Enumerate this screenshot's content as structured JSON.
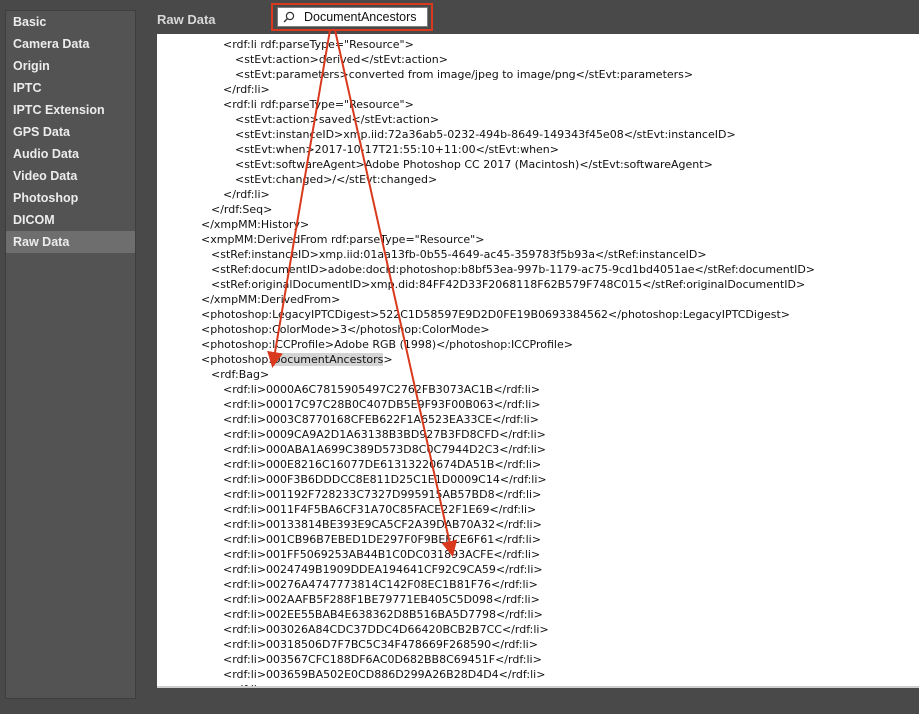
{
  "sidebar": {
    "items": [
      {
        "label": "Basic"
      },
      {
        "label": "Camera Data"
      },
      {
        "label": "Origin"
      },
      {
        "label": "IPTC"
      },
      {
        "label": "IPTC Extension"
      },
      {
        "label": "GPS Data"
      },
      {
        "label": "Audio Data"
      },
      {
        "label": "Video Data"
      },
      {
        "label": "Photoshop"
      },
      {
        "label": "DICOM"
      },
      {
        "label": "Raw Data"
      }
    ],
    "selected": "Raw Data"
  },
  "header": {
    "title": "Raw Data",
    "search_value": "DocumentAncestors",
    "search_icon": "search-icon"
  },
  "colors": {
    "annotation": "#d93a1e",
    "selected_item": "#6e6e6e",
    "text_highlight": "#d4d4d4"
  },
  "xml_lines": [
    "<rdf:li rdf:parseType=\"Resource\">",
    "<stEvt:action>derived</stEvt:action>",
    "<stEvt:parameters>converted from image/jpeg to image/png</stEvt:parameters>",
    "</rdf:li>",
    "<rdf:li rdf:parseType=\"Resource\">",
    "<stEvt:action>saved</stEvt:action>",
    "<stEvt:instanceID>xmp.iid:72a36ab5-0232-494b-8649-149343f45e08</stEvt:instanceID>",
    "<stEvt:when>2017-10-17T21:55:10+11:00</stEvt:when>",
    "<stEvt:softwareAgent>Adobe Photoshop CC 2017 (Macintosh)</stEvt:softwareAgent>",
    "<stEvt:changed>/</stEvt:changed>",
    "</rdf:li>",
    "</rdf:Seq>",
    "</xmpMM:History>",
    "<xmpMM:DerivedFrom rdf:parseType=\"Resource\">",
    "<stRef:instanceID>xmp.iid:01aa13fb-0b55-4649-ac45-359783f5b93a</stRef:instanceID>",
    "<stRef:documentID>adobe:docid:photoshop:b8bf53ea-997b-1179-ac75-9cd1bd4051ae</stRef:documentID>",
    "<stRef:originalDocumentID>xmp.did:84FF42D33F2068118F62B579F748C015</stRef:originalDocumentID>",
    "</xmpMM:DerivedFrom>",
    "<photoshop:LegacyIPTCDigest>522C1D58597E9D2D0FE19B0693384562</photoshop:LegacyIPTCDigest>",
    "<photoshop:ColorMode>3</photoshop:ColorMode>",
    "<photoshop:ICCProfile>Adobe RGB (1998)</photoshop:ICCProfile>",
    "<photoshop:",
    "DocumentAncestors",
    ">",
    "<rdf:Bag>",
    "<rdf:li>0000A6C7815905497C2762FB3073AC1B</rdf:li>",
    "<rdf:li>00017C97C28B0C407DB5E9F93F00B063</rdf:li>",
    "<rdf:li>0003C8770168CFEB622F1A6523EA33CE</rdf:li>",
    "<rdf:li>0009CA9A2D1A63138B3BD927B3FD8CFD</rdf:li>",
    "<rdf:li>000ABA1A699C389D573D8C0C7944D2C3</rdf:li>",
    "<rdf:li>000E8216C16077DE61313220674DA51B</rdf:li>",
    "<rdf:li>000F3B6DDDCC8E811D25C1E1D0009C14</rdf:li>",
    "<rdf:li>001192F728233C7327D995915AB57BD8</rdf:li>",
    "<rdf:li>0011F4F5BA6CF31A70C85FACE22F1E69</rdf:li>",
    "<rdf:li>00133814BE393E9CA5CF2A39DAB70A32</rdf:li>",
    "<rdf:li>001CB96B7EBED1DE297F0F9BEECE6F61</rdf:li>",
    "<rdf:li>001FF5069253AB44B1C0DC031893ACFE</rdf:li>",
    "<rdf:li>0024749B1909DDEA194641CF92C9CA59</rdf:li>",
    "<rdf:li>00276A4747773814C142F08EC1B81F76</rdf:li>",
    "<rdf:li>002AAFB5F288F1BE79771EB405C5D098</rdf:li>",
    "<rdf:li>002EE55BAB4E638362D8B516BA5D7798</rdf:li>",
    "<rdf:li>003026A84CDC37DDC4D66420BCB2B7CC</rdf:li>",
    "<rdf:li>00318506D7F7BC5C34F478669F268590</rdf:li>",
    "<rdf:li>003567CFC188DF6AC0D682BB8C69451F</rdf:li>",
    "<rdf:li>003659BA502E0CD886D299A26B28D4D4</rdf:li>",
    "<rdf:li>"
  ]
}
